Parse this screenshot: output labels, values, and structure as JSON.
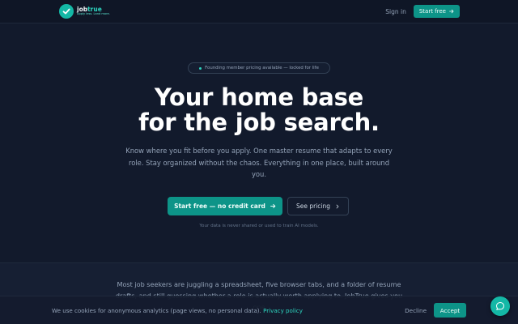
{
  "brand": {
    "name_prefix": "job",
    "name_accent": "true",
    "tagline": "Apply less. Land more.",
    "accent_color": "#14b8a6"
  },
  "nav": {
    "signin_label": "Sign in",
    "start_label": "Start free",
    "start_icon": "arrow-right-icon"
  },
  "hero": {
    "pill_text": "Founding member pricing available — locked for life",
    "headline_line1": "Your home base",
    "headline_line2": "for the job search.",
    "subtext": "Know where you fit before you apply. One master resume that adapts to every role. Stay organized without the chaos. Everything in one place, built around you.",
    "primary_cta": "Start free — no credit card",
    "secondary_cta": "See pricing",
    "privacy_note": "Your data is never shared or used to train AI models."
  },
  "section2": {
    "body": "Most job seekers are juggling a spreadsheet, five browser tabs, and a folder of resume drafts, and still guessing whether a role is actually worth applying to. JobTrue gives you one"
  },
  "cookie": {
    "text": "We use cookies for anonymous analytics (page views, no personal data).",
    "link_label": "Privacy policy",
    "decline_label": "Decline",
    "accept_label": "Accept"
  },
  "chat": {
    "icon": "chat-bubble-icon"
  }
}
